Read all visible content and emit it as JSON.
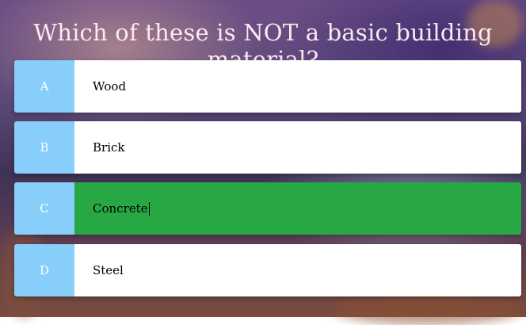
{
  "quiz": {
    "question": "Which of these is NOT a basic building material?",
    "options": [
      {
        "letter": "A",
        "text": "Wood"
      },
      {
        "letter": "B",
        "text": "Brick"
      },
      {
        "letter": "C",
        "text": "Concrete"
      },
      {
        "letter": "D",
        "text": "Steel"
      }
    ],
    "selected": "C"
  },
  "colors": {
    "letter_bg": "#87cefa",
    "option_bg": "#ffffff",
    "selected_bg": "#28a745",
    "question_text": "#fbeaf0"
  }
}
